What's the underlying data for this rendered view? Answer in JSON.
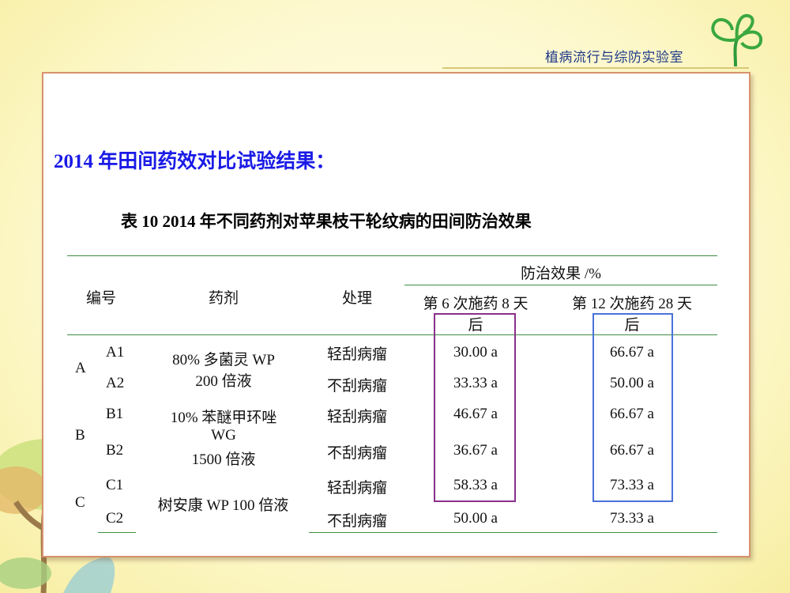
{
  "header": {
    "lab_name": "植病流行与综防实验室"
  },
  "colors": {
    "heading": "#1a1ae6",
    "purple_box": "#8b2f8b",
    "blue_box": "#4a72d9",
    "table_rule": "#3e8e41",
    "panel_border": "#d7926e"
  },
  "heading": "2014 年田间药效对比试验结果：",
  "table": {
    "caption": "表 10  2014 年不同药剂对苹果枝干轮纹病的田间防治效果",
    "headers": {
      "code": "编号",
      "agent": "药剂",
      "treatment": "处理",
      "effect": "防治效果   /%",
      "day6_line1": "第 6 次施药 8 天",
      "day6_line2": "后",
      "day12_line1": "第 12 次施药 28 天",
      "day12_line2": "后"
    },
    "groups": [
      {
        "code": "A",
        "agent_lines": [
          "80% 多菌灵 WP",
          "200 倍液"
        ]
      },
      {
        "code": "B",
        "agent_lines": [
          "10% 苯醚甲环唑",
          "WG",
          "1500 倍液"
        ]
      },
      {
        "code": "C",
        "agent_lines": [
          "树安康 WP 100 倍液"
        ]
      }
    ],
    "rows": [
      {
        "sub": "A1",
        "treatment": "轻刮病瘤",
        "v6": "30.00 a",
        "v12": "66.67 a"
      },
      {
        "sub": "A2",
        "treatment": "不刮病瘤",
        "v6": "33.33 a",
        "v12": "50.00 a"
      },
      {
        "sub": "B1",
        "treatment": "轻刮病瘤",
        "v6": "46.67 a",
        "v12": "66.67 a"
      },
      {
        "sub": "B2",
        "treatment": "不刮病瘤",
        "v6": "36.67 a",
        "v12": "66.67 a"
      },
      {
        "sub": "C1",
        "treatment": "轻刮病瘤",
        "v6": "58.33 a",
        "v12": "73.33 a"
      },
      {
        "sub": "C2",
        "treatment": "不刮病瘤",
        "v6": "50.00 a",
        "v12": "73.33 a"
      }
    ]
  }
}
